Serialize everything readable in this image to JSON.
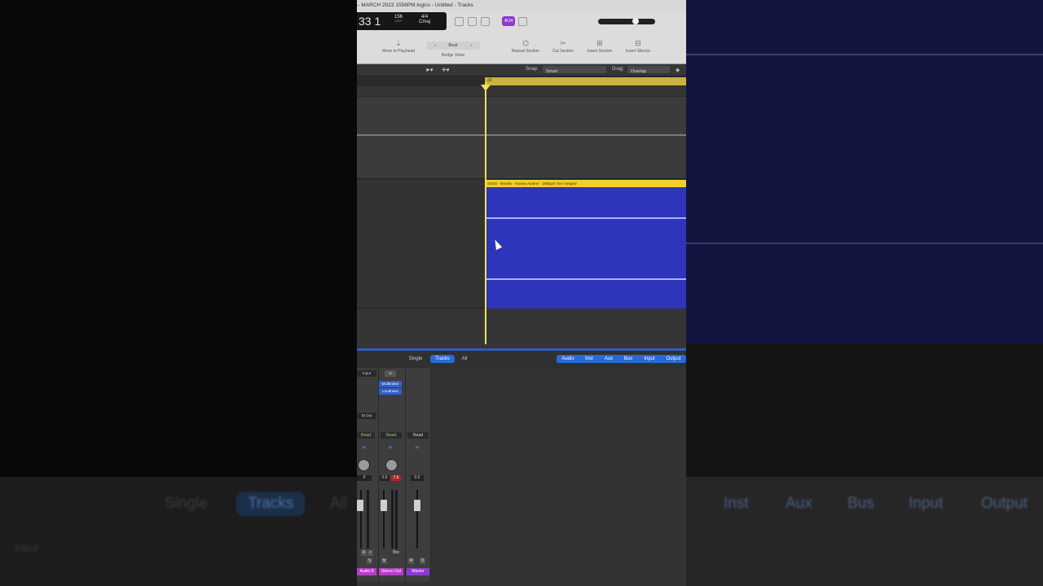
{
  "window": {
    "title": "– MARCH 2023 1558PM.logicx - Untitled - Tracks"
  },
  "lcd": {
    "position": "33 1",
    "tempo": "156",
    "tempo_label": "KEEP",
    "time_signature": "4/4",
    "key": "Cmaj"
  },
  "toolbar": {
    "badge": "⌘34",
    "beat_selector": "Beat",
    "tools": [
      {
        "label": "Move to Playhead",
        "icon": "playhead-icon"
      },
      {
        "label": "Nudge Value",
        "icon": "nudge-icon"
      },
      {
        "label": "Repeat Section",
        "icon": "repeat-section-icon"
      },
      {
        "label": "Cut Section",
        "icon": "cut-section-icon"
      },
      {
        "label": "Insert Section",
        "icon": "insert-section-icon"
      },
      {
        "label": "Insert Silence",
        "icon": "insert-silence-icon"
      }
    ]
  },
  "editbar": {
    "snap_label": "Snap:",
    "snap_value": "Smart",
    "drag_label": "Drag:",
    "drag_value": "Overlap"
  },
  "ruler": {
    "marker": "33"
  },
  "region": {
    "title": "SSDS - Breaks - Noisey Amens - 156bpm Tom merged",
    "color": "#2f35b8",
    "header_color": "#f2cf2a"
  },
  "mixer": {
    "views": [
      "Single",
      "Tracks",
      "All"
    ],
    "active_view": "Tracks",
    "filters": [
      "Audio",
      "Inst",
      "Aux",
      "Bus",
      "Input",
      "Output"
    ],
    "strips": [
      {
        "input": "Input",
        "plugins": [],
        "output": "St Out",
        "automation": "Read",
        "volume": "0",
        "buttons": [
          "R",
          "I",
          "S"
        ],
        "name": "Audio 8",
        "name_color": "#b83cc9"
      },
      {
        "input": "",
        "plugins": [
          "Multimeter",
          "Loudness"
        ],
        "output": "",
        "automation": "Read",
        "volume": "0.0",
        "peak": "7.6",
        "buttons": [
          "Bnc",
          "M"
        ],
        "name": "Stereo Out",
        "name_color": "#b83cc9"
      },
      {
        "input": "",
        "plugins": [],
        "output": "",
        "automation": "Read",
        "volume": "0.0",
        "buttons": [
          "M",
          "D"
        ],
        "name": "Master",
        "name_color": "#8e3ad1"
      }
    ]
  },
  "backdrop": {
    "views": [
      "Single",
      "Tracks",
      "All"
    ],
    "filters": [
      "Inst",
      "Aux",
      "Bus",
      "Input",
      "Output"
    ],
    "input": "Input"
  }
}
